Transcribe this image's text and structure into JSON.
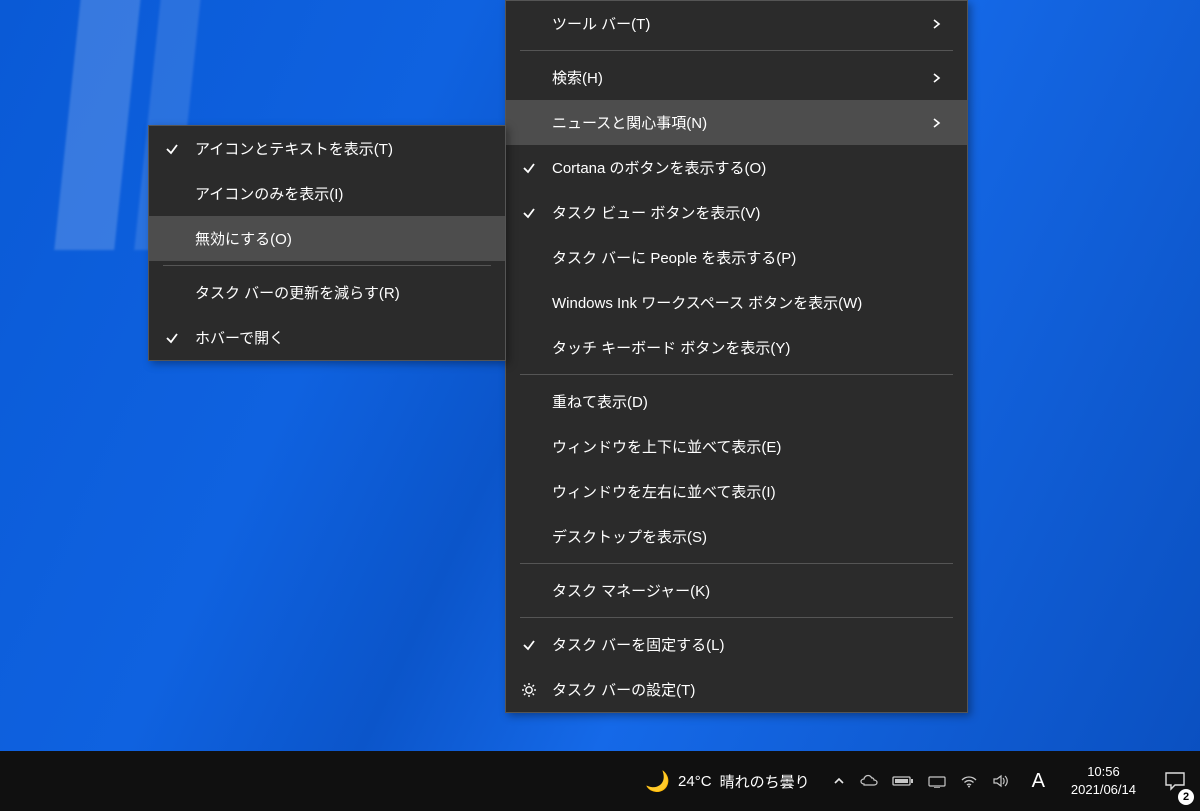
{
  "main_menu": {
    "items": [
      {
        "label": "ツール バー(T)",
        "arrow": true
      },
      {
        "sep": true
      },
      {
        "label": "検索(H)",
        "arrow": true
      },
      {
        "label": "ニュースと関心事項(N)",
        "arrow": true,
        "hover": true
      },
      {
        "label": "Cortana のボタンを表示する(O)",
        "check": true
      },
      {
        "label": "タスク ビュー ボタンを表示(V)",
        "check": true
      },
      {
        "label": "タスク バーに People を表示する(P)"
      },
      {
        "label": "Windows Ink ワークスペース ボタンを表示(W)"
      },
      {
        "label": "タッチ キーボード ボタンを表示(Y)"
      },
      {
        "sep": true
      },
      {
        "label": "重ねて表示(D)"
      },
      {
        "label": "ウィンドウを上下に並べて表示(E)"
      },
      {
        "label": "ウィンドウを左右に並べて表示(I)"
      },
      {
        "label": "デスクトップを表示(S)"
      },
      {
        "sep": true
      },
      {
        "label": "タスク マネージャー(K)"
      },
      {
        "sep": true
      },
      {
        "label": "タスク バーを固定する(L)",
        "check": true
      },
      {
        "label": "タスク バーの設定(T)",
        "gear": true
      }
    ]
  },
  "sub_menu": {
    "items": [
      {
        "label": "アイコンとテキストを表示(T)",
        "check": true
      },
      {
        "label": "アイコンのみを表示(I)"
      },
      {
        "label": "無効にする(O)",
        "hover": true
      },
      {
        "sep": true
      },
      {
        "label": "タスク バーの更新を減らす(R)"
      },
      {
        "label": "ホバーで開く",
        "check": true
      }
    ]
  },
  "taskbar": {
    "weather_temp": "24°C",
    "weather_text": "晴れのち曇り",
    "ime": "A",
    "time": "10:56",
    "date": "2021/06/14",
    "notification_count": "2"
  }
}
